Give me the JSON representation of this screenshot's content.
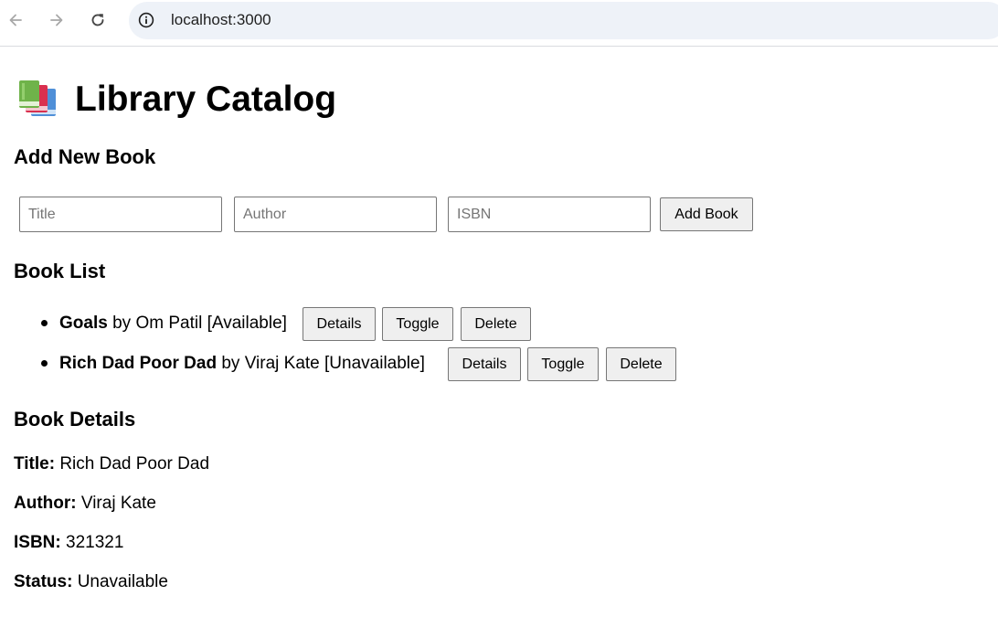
{
  "browser": {
    "url": "localhost:3000",
    "icons": {
      "back": "arrow-left-icon",
      "forward": "arrow-right-icon",
      "reload": "reload-icon",
      "site_info": "info-circle-icon"
    }
  },
  "page": {
    "title": "Library Catalog",
    "title_emoji": "books-emoji-icon"
  },
  "add_form": {
    "heading": "Add New Book",
    "title_placeholder": "Title",
    "author_placeholder": "Author",
    "isbn_placeholder": "ISBN",
    "title_value": "",
    "author_value": "",
    "isbn_value": "",
    "submit_label": "Add Book"
  },
  "book_list": {
    "heading": "Book List",
    "items": [
      {
        "title": "Goals",
        "by": "by",
        "author": "Om Patil",
        "status": "[Available]",
        "details_label": "Details",
        "toggle_label": "Toggle",
        "delete_label": "Delete"
      },
      {
        "title": "Rich Dad Poor Dad",
        "by": "by",
        "author": "Viraj Kate",
        "status": "[Unavailable]",
        "details_label": "Details",
        "toggle_label": "Toggle",
        "delete_label": "Delete"
      }
    ]
  },
  "details": {
    "heading": "Book Details",
    "title_label": "Title:",
    "title_value": "Rich Dad Poor Dad",
    "author_label": "Author:",
    "author_value": "Viraj Kate",
    "isbn_label": "ISBN:",
    "isbn_value": "321321",
    "status_label": "Status:",
    "status_value": "Unavailable"
  },
  "colors": {
    "omnibox_bg": "#eef2f8",
    "button_bg": "#efefef",
    "border": "#767676"
  }
}
